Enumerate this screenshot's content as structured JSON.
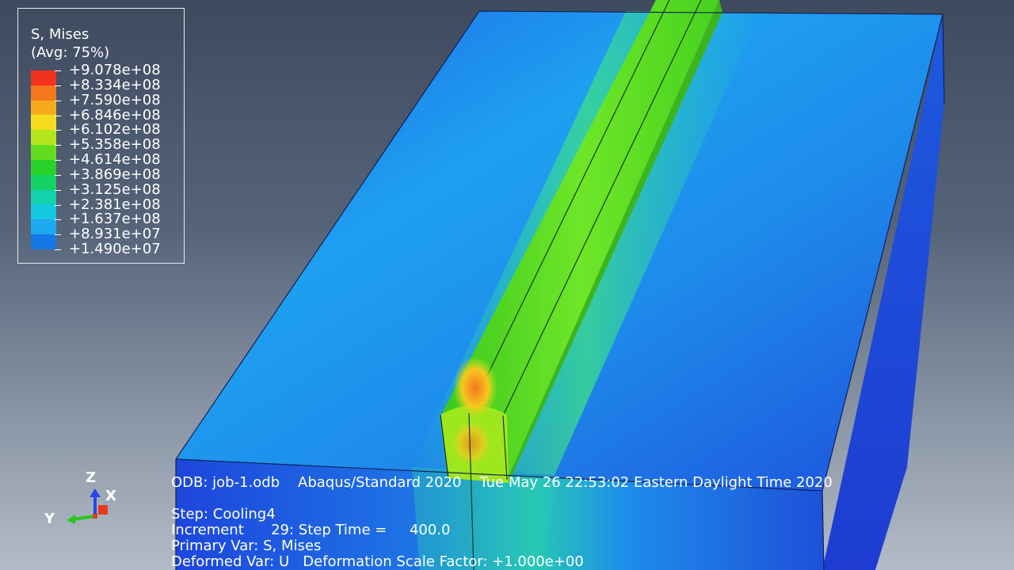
{
  "legend": {
    "title": "S, Mises",
    "subtitle": "(Avg: 75%)",
    "labels": [
      "+9.078e+08",
      "+8.334e+08",
      "+7.590e+08",
      "+6.846e+08",
      "+6.102e+08",
      "+5.358e+08",
      "+4.614e+08",
      "+3.869e+08",
      "+3.125e+08",
      "+2.381e+08",
      "+1.637e+08",
      "+8.931e+07",
      "+1.490e+07"
    ],
    "colors": [
      "#f0321e",
      "#f5781e",
      "#f5aa1e",
      "#f5dc1e",
      "#b4e61e",
      "#64dc1e",
      "#28d228",
      "#14d264",
      "#14d2aa",
      "#14c8e1",
      "#1eaaf0",
      "#1478e6",
      "#1e3cdc"
    ]
  },
  "info": {
    "odb": "ODB: job-1.odb    Abaqus/Standard 2020    Tue May 26 22:53:02 Eastern Daylight Time 2020",
    "step": "Step: Cooling4",
    "increment": "Increment      29: Step Time =     400.0",
    "primary": "Primary Var: S, Mises",
    "deformed": "Deformed Var: U   Deformation Scale Factor: +1.000e+00"
  },
  "triad": {
    "z": "Z",
    "x": "X",
    "y": "Y"
  }
}
